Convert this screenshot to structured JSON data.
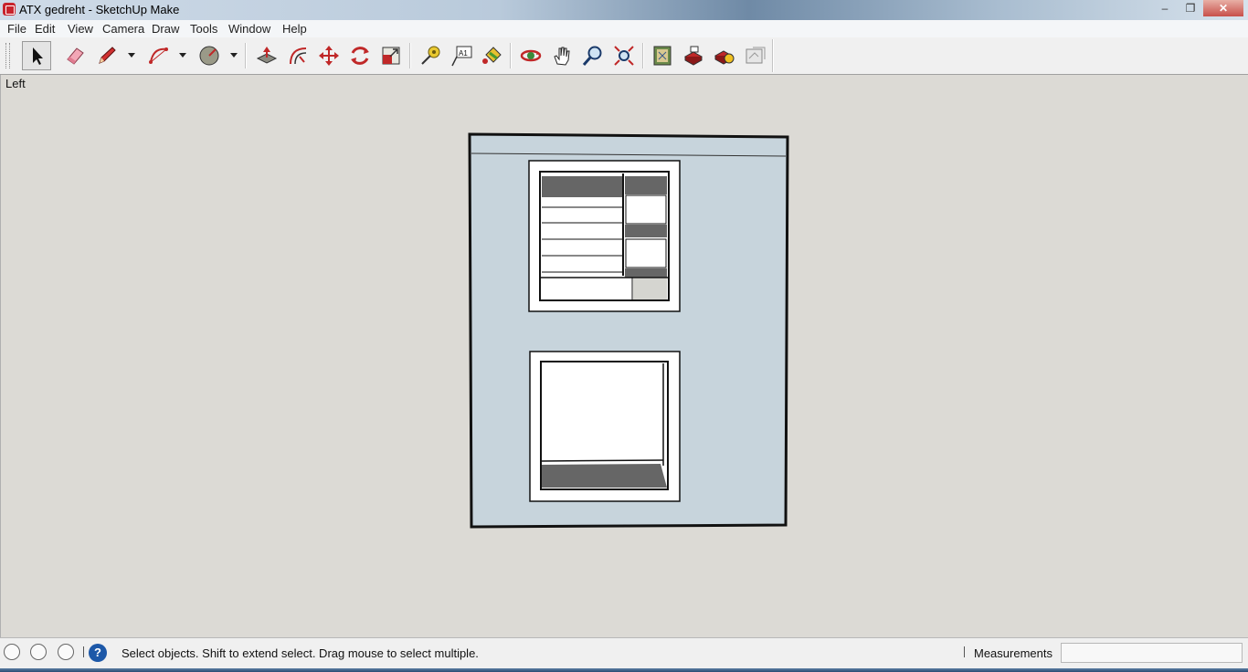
{
  "window": {
    "title": "ATX gedreht - SketchUp Make",
    "controls": {
      "minimize": "–",
      "maximize": "❐",
      "close": "✕"
    }
  },
  "menu": [
    "File",
    "Edit",
    "View",
    "Camera",
    "Draw",
    "Tools",
    "Window",
    "Help"
  ],
  "toolbar": {
    "tools": [
      {
        "name": "select-tool",
        "icon": "select-arrow-icon",
        "active": true
      },
      {
        "name": "eraser-tool",
        "icon": "eraser-icon"
      },
      {
        "name": "line-tool",
        "icon": "pencil-icon",
        "dropdown": true
      },
      {
        "name": "arc-tool",
        "icon": "arc-icon",
        "dropdown": true
      },
      {
        "name": "shapes-tool",
        "icon": "circle-icon",
        "dropdown": true
      },
      {
        "name": "push-pull-tool",
        "icon": "push-pull-icon"
      },
      {
        "name": "offset-tool",
        "icon": "offset-icon"
      },
      {
        "name": "move-tool",
        "icon": "move-arrows-icon"
      },
      {
        "name": "rotate-tool",
        "icon": "rotate-icon"
      },
      {
        "name": "scale-tool",
        "icon": "scale-icon"
      },
      {
        "name": "tape-measure-tool",
        "icon": "tape-measure-icon"
      },
      {
        "name": "text-tool",
        "icon": "text-label-icon"
      },
      {
        "name": "paint-bucket-tool",
        "icon": "paint-bucket-icon"
      },
      {
        "name": "orbit-tool",
        "icon": "orbit-icon"
      },
      {
        "name": "pan-tool",
        "icon": "hand-icon"
      },
      {
        "name": "zoom-tool",
        "icon": "magnifier-icon"
      },
      {
        "name": "zoom-extents-tool",
        "icon": "zoom-extents-icon"
      },
      {
        "name": "3d-warehouse-button",
        "icon": "map-book-icon"
      },
      {
        "name": "share-model-button",
        "icon": "share-model-icon"
      },
      {
        "name": "extension-warehouse-button",
        "icon": "extension-icon"
      },
      {
        "name": "layout-send-button",
        "icon": "layout-icon"
      }
    ],
    "text_tool_glyph": "A1"
  },
  "viewport": {
    "scene_label": "Left"
  },
  "status": {
    "message": "Select objects. Shift to extend select. Drag mouse to select multiple.",
    "help_glyph": "?",
    "measurements_label": "Measurements",
    "measurements_value": ""
  },
  "colors": {
    "panel_face": "#c7d4dc",
    "dark_fill": "#666666",
    "light_fill": "#d5d5d0",
    "close_button": "#c8504a",
    "help_icon": "#1d58a8"
  }
}
